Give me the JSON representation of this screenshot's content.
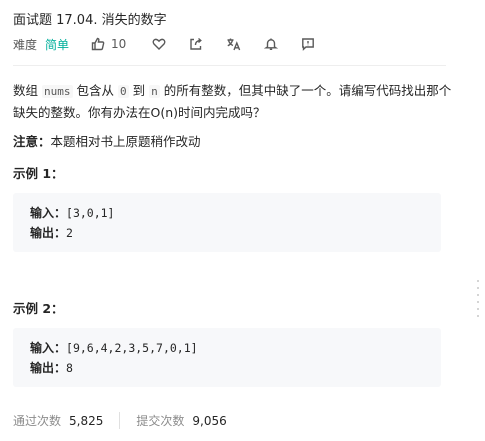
{
  "title": "面试题 17.04. 消失的数字",
  "meta": {
    "difficulty_label": "难度",
    "difficulty": "简单",
    "likes": "10"
  },
  "description": {
    "p1_a": "数组",
    "p1_code1": "nums",
    "p1_b": "包含从",
    "p1_code2": "0",
    "p1_c": "到",
    "p1_code3": "n",
    "p1_d": "的所有整数，但其中缺了一个。请编写代码找出那个缺失的整数。你有办法在O(n)时间内完成吗？"
  },
  "note": {
    "label": "注意：",
    "text": "本题相对书上原题稍作改动"
  },
  "examples": [
    {
      "heading": "示例 1：",
      "input_label": "输入：",
      "input": "[3,0,1]",
      "output_label": "输出：",
      "output": "2"
    },
    {
      "heading": "示例 2：",
      "input_label": "输入：",
      "input": "[9,6,4,2,3,5,7,0,1]",
      "output_label": "输出：",
      "output": "8"
    }
  ],
  "stats": {
    "accepted_label": "通过次数",
    "accepted": "5,825",
    "submissions_label": "提交次数",
    "submissions": "9,056"
  },
  "icons": [
    "thumbs-up-icon",
    "heart-icon",
    "share-icon",
    "translate-icon",
    "bell-icon",
    "feedback-icon"
  ]
}
